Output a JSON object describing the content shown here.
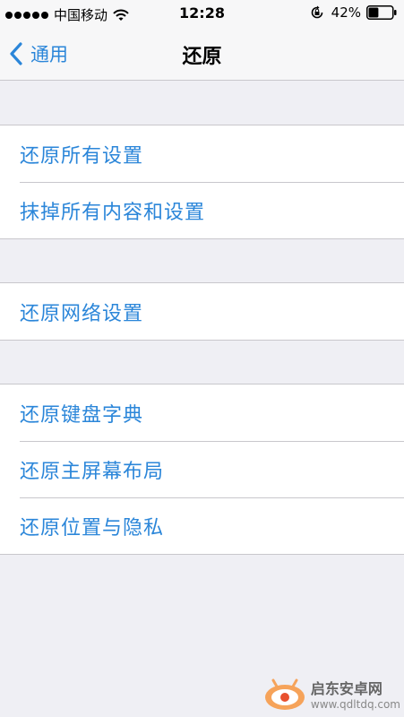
{
  "status_bar": {
    "carrier": "中国移动",
    "time": "12:28",
    "battery_percent": "42%",
    "battery_level": 0.42,
    "icons": [
      "signal-dots",
      "wifi-icon",
      "orientation-lock-icon",
      "battery-icon"
    ]
  },
  "nav": {
    "back_label": "通用",
    "title": "还原"
  },
  "groups": [
    {
      "items": [
        {
          "label": "还原所有设置"
        },
        {
          "label": "抹掉所有内容和设置"
        }
      ]
    },
    {
      "items": [
        {
          "label": "还原网络设置"
        }
      ]
    },
    {
      "items": [
        {
          "label": "还原键盘字典"
        },
        {
          "label": "还原主屏幕布局"
        },
        {
          "label": "还原位置与隐私"
        }
      ]
    }
  ],
  "watermark": {
    "name": "启东安卓网",
    "url": "www.qdltdq.com"
  },
  "colors": {
    "accent": "#2b86d9",
    "background": "#efeff4",
    "separator": "#c8c7cc"
  }
}
